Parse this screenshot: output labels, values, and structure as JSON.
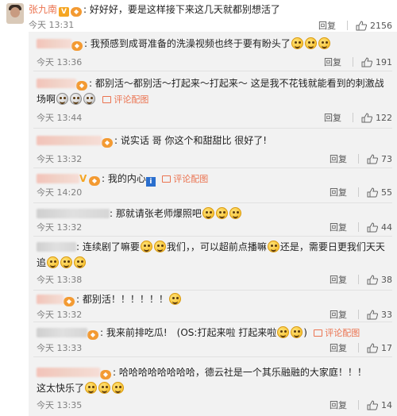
{
  "top_comment": {
    "author": "张九南",
    "text": "好好好，要是这样接下来这几天就都别想活了",
    "time": "今天 13:31",
    "reply_label": "回复",
    "likes": "2156"
  },
  "replies": [
    {
      "text": "我预感到成哥准备的洗澡视频也终于要有盼头了",
      "time": "今天 13:36",
      "reply_label": "回复",
      "likes": "191"
    },
    {
      "text": "都别活～都别活～打起来～打起来～ 这是我不花钱就能看到的刺激战",
      "text2": "场啊",
      "pic_label": "评论配图",
      "time": "今天 13:44",
      "reply_label": "回复",
      "likes": "122"
    },
    {
      "text": "说实话 哥 你这个和甜甜比 很好了!",
      "time": "今天 13:32",
      "reply_label": "回复",
      "likes": "73"
    },
    {
      "text": "我的内心",
      "pic_label": "评论配图",
      "time": "今天 14:20",
      "reply_label": "回复",
      "likes": "55"
    },
    {
      "text": "那就请张老师爆照吧",
      "time": "今天 13:32",
      "reply_label": "回复",
      "likes": "44"
    },
    {
      "text": "连续剧了嘛要",
      "text_b": "我们，，可以超前点播嘛",
      "text_c": "还是，需要日更我们天天",
      "text2": "追",
      "time": "今天 13:38",
      "reply_label": "回复",
      "likes": "38"
    },
    {
      "text": "都别活！！！！！！",
      "time": "今天 13:32",
      "reply_label": "回复",
      "likes": "33"
    },
    {
      "text": "我来前排吃瓜!　(OS:打起来啦 打起来啦",
      "text_b": ")",
      "pic_label": "评论配图",
      "time": "今天 13:33",
      "reply_label": "回复",
      "likes": "17"
    },
    {
      "text": "哈哈哈哈哈哈哈哈，德云社是一个其乐融融的大家庭！！！",
      "text2": "这太快乐了",
      "time": "今天 13:35",
      "reply_label": "回复",
      "likes": "14"
    }
  ]
}
